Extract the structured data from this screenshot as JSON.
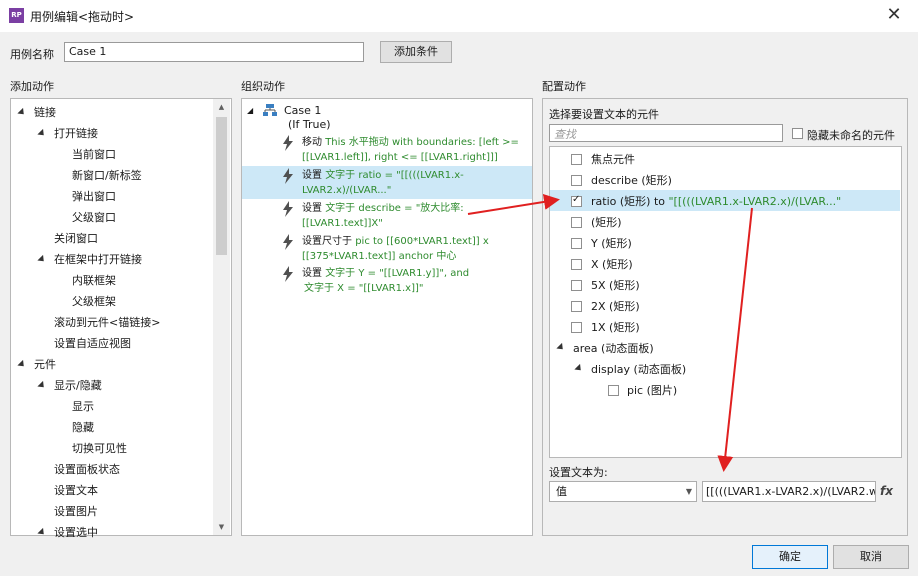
{
  "window": {
    "title": "用例编辑<拖动时>",
    "app_badge": "RP"
  },
  "case": {
    "label": "用例名称",
    "value": "Case 1",
    "add_condition": "添加条件"
  },
  "sections": {
    "add_action": "添加动作",
    "organize": "组织动作",
    "configure": "配置动作"
  },
  "left_tree": [
    {
      "label": "链接",
      "level": 0,
      "expanded": true
    },
    {
      "label": "打开链接",
      "level": 1,
      "expanded": true
    },
    {
      "label": "当前窗口",
      "level": 2
    },
    {
      "label": "新窗口/新标签",
      "level": 2
    },
    {
      "label": "弹出窗口",
      "level": 2
    },
    {
      "label": "父级窗口",
      "level": 2
    },
    {
      "label": "关闭窗口",
      "level": 1
    },
    {
      "label": "在框架中打开链接",
      "level": 1,
      "expanded": true
    },
    {
      "label": "内联框架",
      "level": 2
    },
    {
      "label": "父级框架",
      "level": 2
    },
    {
      "label": "滚动到元件<锚链接>",
      "level": 1
    },
    {
      "label": "设置自适应视图",
      "level": 1
    },
    {
      "label": "元件",
      "level": 0,
      "expanded": true
    },
    {
      "label": "显示/隐藏",
      "level": 1,
      "expanded": true
    },
    {
      "label": "显示",
      "level": 2
    },
    {
      "label": "隐藏",
      "level": 2
    },
    {
      "label": "切换可见性",
      "level": 2
    },
    {
      "label": "设置面板状态",
      "level": 1
    },
    {
      "label": "设置文本",
      "level": 1
    },
    {
      "label": "设置图片",
      "level": 1
    },
    {
      "label": "设置选中",
      "level": 1,
      "expanded": true
    }
  ],
  "organize": {
    "case_title": "Case 1",
    "case_cond": "(If True)",
    "actions": [
      {
        "prefix": "移动 ",
        "body": "This 水平拖动 with boundaries: [left >= [[LVAR1.left]], right <= [[LVAR1.right]]]"
      },
      {
        "prefix": "设置 ",
        "body": "文字于 ratio = \"[[(((LVAR1.x-LVAR2.x)/(LVAR...\""
      },
      {
        "prefix": "设置 ",
        "body": "文字于 describe = \"放大比率: [[LVAR1.text]]X\""
      },
      {
        "prefix": "设置尺寸于 ",
        "body": "pic to [[600*LVAR1.text]] x [[375*LVAR1.text]] anchor 中心"
      },
      {
        "prefix": "设置 ",
        "body": "文字于 Y = \"[[LVAR1.y]]\", and",
        "line2": "文字于 X = \"[[LVAR1.x]]\""
      }
    ]
  },
  "configure": {
    "select_label": "选择要设置文本的元件",
    "search_placeholder": "查找",
    "hide_unnamed": "隐藏未命名的元件",
    "items": [
      {
        "label": "焦点元件",
        "checked": false
      },
      {
        "label": "describe (矩形)",
        "checked": false
      },
      {
        "label": "ratio (矩形) to ",
        "suffix": "\"[[(((LVAR1.x-LVAR2.x)/(LVAR...\"",
        "checked": true
      },
      {
        "label": "(矩形)",
        "checked": false
      },
      {
        "label": "Y (矩形)",
        "checked": false
      },
      {
        "label": "X (矩形)",
        "checked": false
      },
      {
        "label": "5X (矩形)",
        "checked": false
      },
      {
        "label": "2X (矩形)",
        "checked": false
      },
      {
        "label": "1X (矩形)",
        "checked": false
      }
    ],
    "groups": [
      {
        "label": "area (动态面板)"
      },
      {
        "label": "display (动态面板)"
      },
      {
        "label": "pic (图片)"
      }
    ],
    "set_text_label": "设置文本为:",
    "value_type": "值",
    "value_text": "[[(((LVAR1.x-LVAR2.x)/(LVAR2.wi",
    "fx": "fx"
  },
  "buttons": {
    "ok": "确定",
    "cancel": "取消"
  },
  "colors": {
    "accent": "#2e8b2e",
    "selection": "#cde8f7",
    "arrow": "#e02020"
  }
}
